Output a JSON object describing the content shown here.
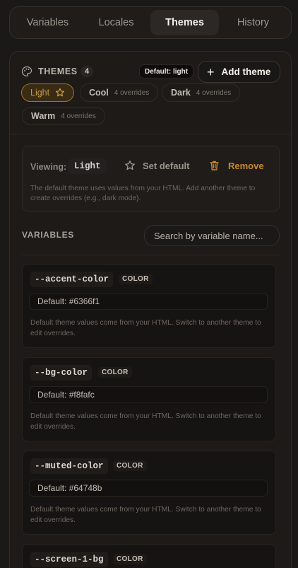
{
  "tabs": [
    {
      "label": "Variables",
      "active": false
    },
    {
      "label": "Locales",
      "active": false
    },
    {
      "label": "Themes",
      "active": true
    },
    {
      "label": "History",
      "active": false
    }
  ],
  "themes_header": {
    "title": "THEMES",
    "count": "4",
    "default_badge": "Default: light",
    "add_button": "Add theme"
  },
  "theme_chips": [
    {
      "name": "Light",
      "overrides": "",
      "active": true
    },
    {
      "name": "Cool",
      "overrides": "4 overrides",
      "active": false
    },
    {
      "name": "Dark",
      "overrides": "4 overrides",
      "active": false
    },
    {
      "name": "Warm",
      "overrides": "4 overrides",
      "active": false
    }
  ],
  "viewing": {
    "label": "Viewing:",
    "value": "Light",
    "set_default": "Set default",
    "remove": "Remove",
    "description": "The default theme uses values from your HTML. Add another theme to create overrides (e.g., dark mode)."
  },
  "variables": {
    "title": "VARIABLES",
    "search_placeholder": "Search by variable name...",
    "items": [
      {
        "name": "--accent-color",
        "type": "COLOR",
        "default": "Default: #6366f1",
        "note": "Default theme values come from your HTML. Switch to another theme to edit overrides."
      },
      {
        "name": "--bg-color",
        "type": "COLOR",
        "default": "Default: #f8fafc",
        "note": "Default theme values come from your HTML. Switch to another theme to edit overrides."
      },
      {
        "name": "--muted-color",
        "type": "COLOR",
        "default": "Default: #64748b",
        "note": "Default theme values come from your HTML. Switch to another theme to edit overrides."
      },
      {
        "name": "--screen-1-bg",
        "type": "COLOR",
        "default": "",
        "note": ""
      }
    ]
  },
  "colors": {
    "accent_amber": "#c9892a",
    "background": "#1b1917"
  }
}
